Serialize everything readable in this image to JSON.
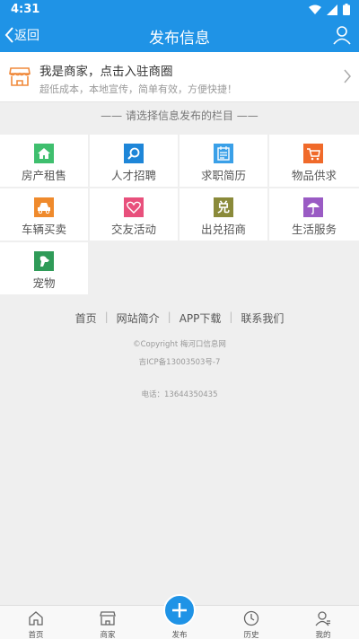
{
  "status": {
    "time": "4:31"
  },
  "header": {
    "back_label": "返回",
    "title": "发布信息"
  },
  "merchant": {
    "title": "我是商家，点击入驻商圈",
    "subtitle": "超低成本，本地宣传，简单有效，方便快捷！"
  },
  "section_title": "—— 请选择信息发布的栏目 ——",
  "categories": [
    {
      "label": "房产租售",
      "icon": "house-icon",
      "color": "#3fbf6e"
    },
    {
      "label": "人才招聘",
      "icon": "magnifier-icon",
      "color": "#1e86d8"
    },
    {
      "label": "求职简历",
      "icon": "document-icon",
      "color": "#3aa0e8"
    },
    {
      "label": "物品供求",
      "icon": "cart-icon",
      "color": "#f06a2a"
    },
    {
      "label": "车辆买卖",
      "icon": "car-icon",
      "color": "#ef8a2c"
    },
    {
      "label": "交友活动",
      "icon": "heart-icon",
      "color": "#e8507c"
    },
    {
      "label": "出兑招商",
      "icon": "dui-icon",
      "color": "#8a8a3a"
    },
    {
      "label": "生活服务",
      "icon": "umbrella-icon",
      "color": "#9a5bc4"
    },
    {
      "label": "宠物",
      "icon": "dog-icon",
      "color": "#2f9b58"
    }
  ],
  "footer": {
    "links": [
      "首页",
      "网站简介",
      "APP下载",
      "联系我们"
    ],
    "copyright": "©Copyright  梅河口信息网",
    "icp": "吉ICP备13003503号-7",
    "phone": "电话：13644350435"
  },
  "tabs": [
    {
      "label": "首页",
      "icon": "home-icon"
    },
    {
      "label": "商家",
      "icon": "shop-icon"
    },
    {
      "label": "发布",
      "icon": "plus-icon"
    },
    {
      "label": "历史",
      "icon": "clock-icon"
    },
    {
      "label": "我的",
      "icon": "profile-icon"
    }
  ],
  "colors": {
    "primary": "#1f93e6",
    "merchant_icon": "#f08a3c"
  }
}
